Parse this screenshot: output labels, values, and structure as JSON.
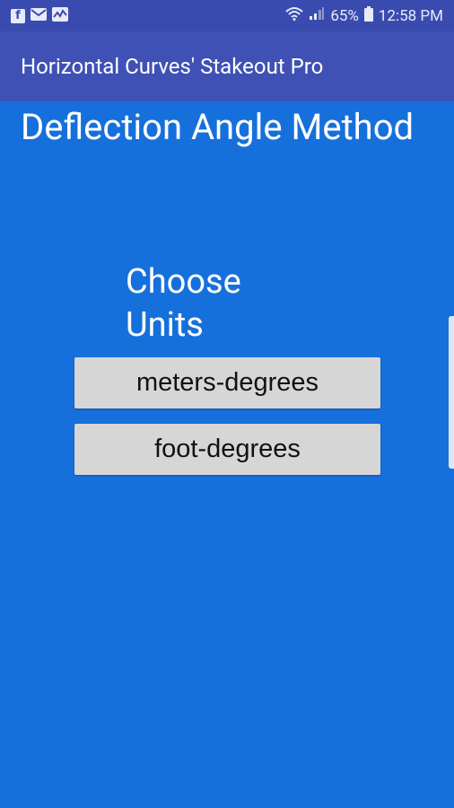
{
  "status_bar": {
    "battery_percent": "65%",
    "time": "12:58 PM",
    "left_icons": [
      "facebook-icon",
      "mail-icon",
      "activity-icon"
    ],
    "right_icons": [
      "wifi-icon",
      "signal-icon",
      "battery-icon"
    ]
  },
  "app_bar": {
    "title": "Horizontal Curves' Stakeout Pro"
  },
  "main": {
    "heading": "Deflection Angle Method",
    "choose_label_line1": "Choose",
    "choose_label_line2": "Units",
    "buttons": [
      {
        "label": "meters-degrees"
      },
      {
        "label": "foot-degrees"
      }
    ]
  },
  "colors": {
    "background": "#1670dc",
    "app_bar": "#3f51b5",
    "status_bar": "#3a4bb0",
    "button": "#d6d6d6"
  }
}
